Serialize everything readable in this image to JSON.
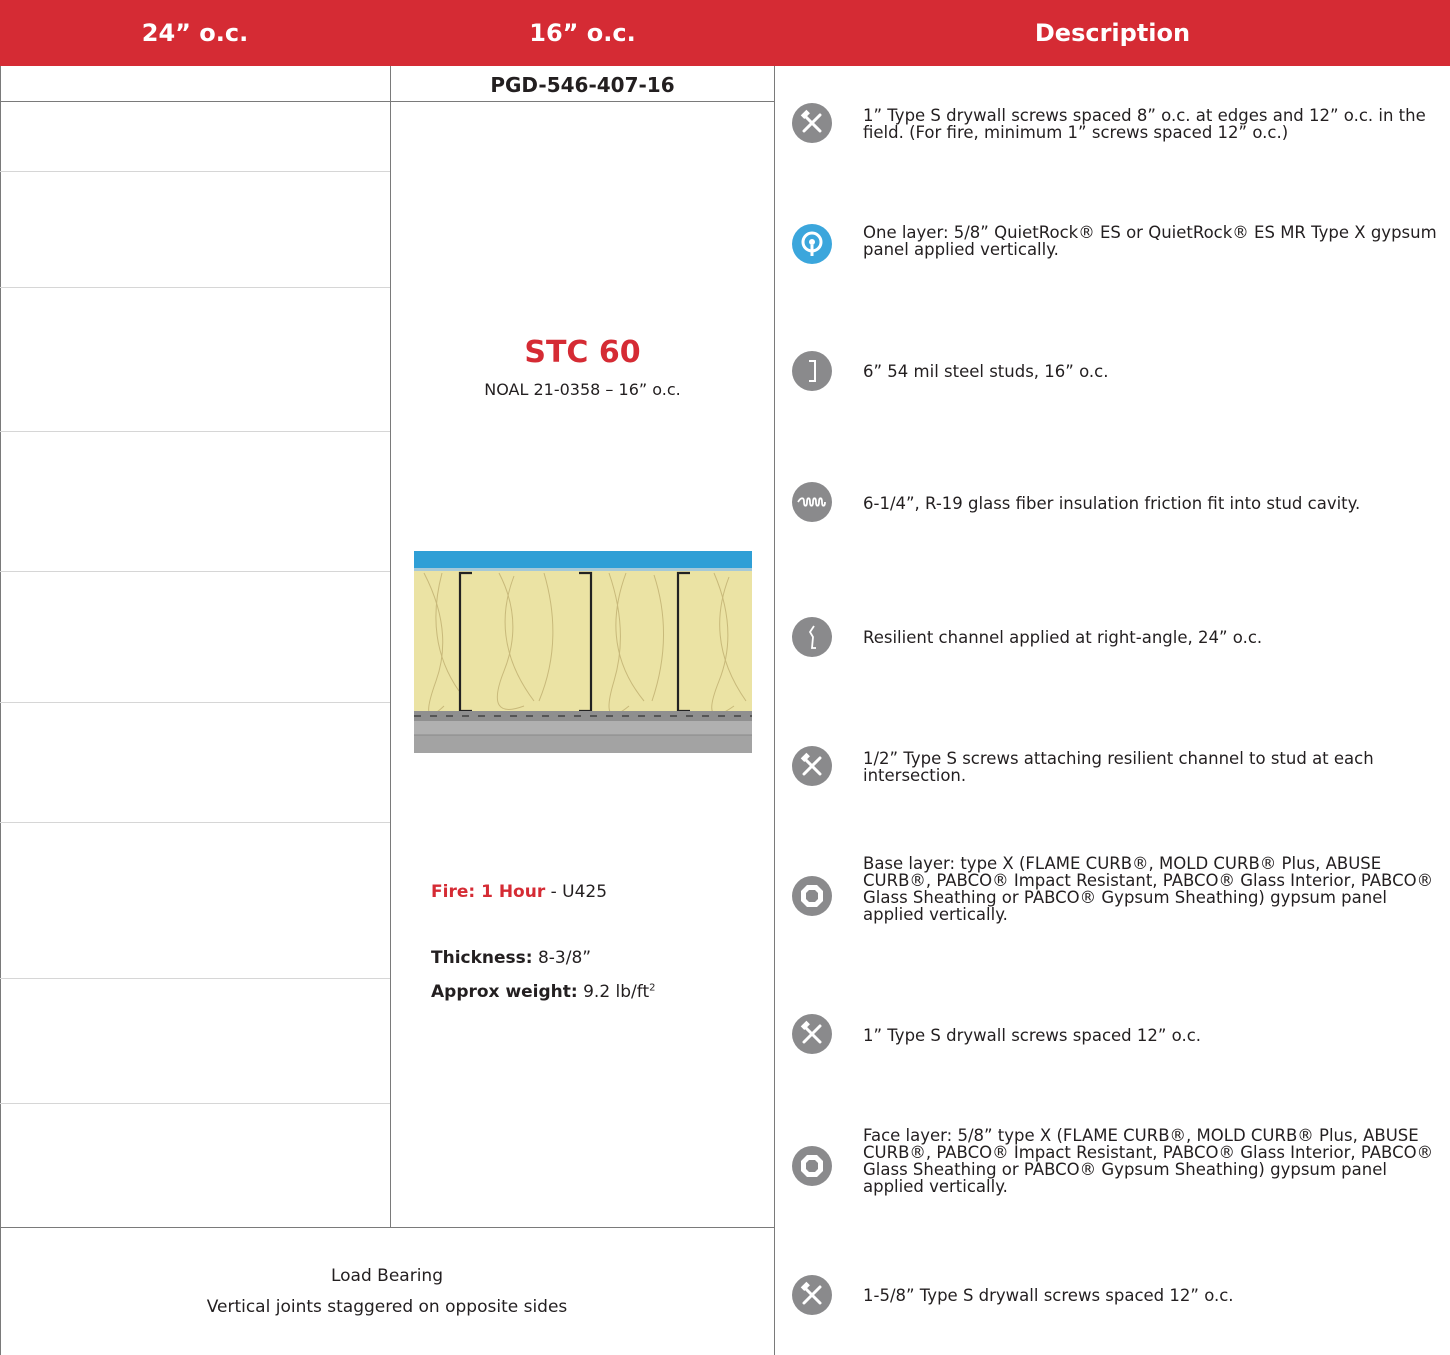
{
  "header": {
    "col1": "24” o.c.",
    "col2": "16” o.c.",
    "col3": "Description"
  },
  "assembly": {
    "code": "PGD-546-407-16",
    "stc": "STC 60",
    "noal": "NOAL 21-0358 – 16” o.c.",
    "fire_label": "Fire: 1 Hour",
    "fire_rest": " - U425",
    "thickness_label": "Thickness:",
    "thickness_value": " 8-3/8”",
    "weight_label": "Approx weight:",
    "weight_value": " 9.2 lb/ft",
    "weight_exp": "2"
  },
  "notes": {
    "line1": "Load Bearing",
    "line2": "Vertical joints staggered on opposite sides"
  },
  "descriptions": [
    {
      "icon": "screw-icon",
      "text": "1” Type S drywall screws spaced 8” o.c. at edges and 12” o.c. in the field. (For fire, minimum  1” screws spaced 12” o.c.)"
    },
    {
      "icon": "quietrock-icon",
      "text": "One layer: 5/8” QuietRock® ES or QuietRock® ES MR Type X gypsum panel applied vertically."
    },
    {
      "icon": "steel-stud-icon",
      "text": "6” 54 mil steel studs, 16” o.c."
    },
    {
      "icon": "insulation-icon",
      "text": "6-1/4”, R-19 glass fiber insulation friction fit into stud cavity."
    },
    {
      "icon": "resilient-channel-icon",
      "text": "Resilient channel applied at right-angle, 24” o.c."
    },
    {
      "icon": "screw-icon",
      "text": "1/2” Type S screws attaching resilient channel to stud at each intersection."
    },
    {
      "icon": "gypsum-panel-icon",
      "text": "Base layer:  type X (FLAME CURB®, MOLD CURB® Plus, ABUSE CURB®, PABCO® Impact Resistant, PABCO® Glass Interior, PABCO® Glass Sheathing or PABCO® Gypsum Sheathing) gypsum panel applied vertically."
    },
    {
      "icon": "screw-icon",
      "text": "1” Type S drywall screws spaced 12” o.c."
    },
    {
      "icon": "gypsum-panel-icon",
      "text": "Face layer: 5/8” type X (FLAME CURB®, MOLD CURB® Plus, ABUSE CURB®, PABCO® Impact Resistant, PABCO® Glass Interior, PABCO® Glass Sheathing or PABCO® Gypsum Sheathing) gypsum panel applied vertically."
    },
    {
      "icon": "screw-icon",
      "text": "1-5/8” Type S drywall screws spaced 12” o.c."
    }
  ],
  "colors": {
    "brand_red": "#d52b34",
    "icon_gray": "#8a8a8c",
    "icon_blue": "#3ba6dc",
    "panel_blue": "#2f9fd6",
    "insulation": "#ebe3a4"
  }
}
